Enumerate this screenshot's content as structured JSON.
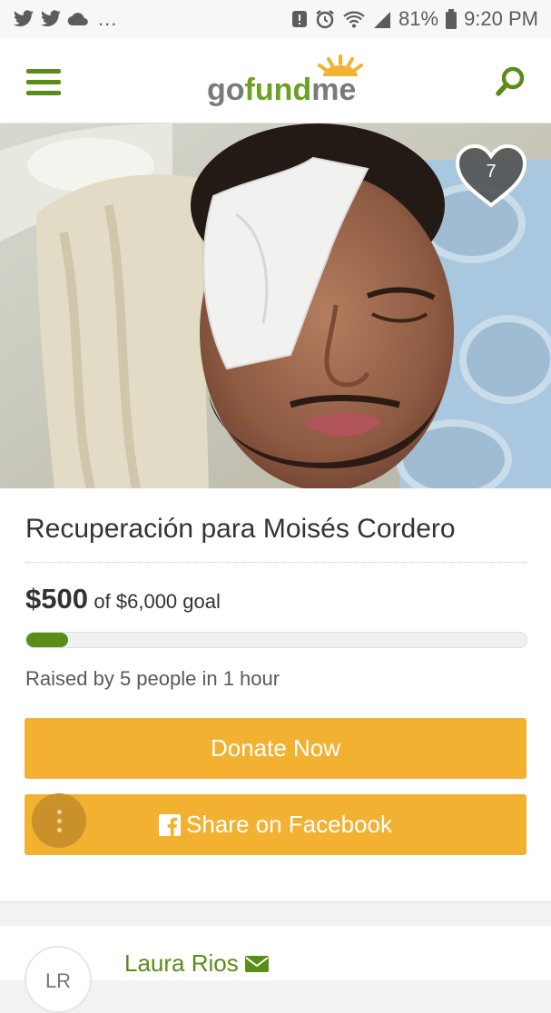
{
  "status_bar": {
    "left_icons": [
      "twitter-icon",
      "twitter-icon",
      "cloud-icon"
    ],
    "more": "...",
    "battery": "81%",
    "time": "9:20 PM"
  },
  "nav": {
    "logo": {
      "part1": "go",
      "part2": "fund",
      "part3": "me"
    }
  },
  "campaign": {
    "heart_count": "7",
    "title": "Recuperación para Moisés Cordero",
    "raised": "$500",
    "goal_text": "of $6,000 goal",
    "progress_fraction": 0.0833,
    "raised_by": "Raised by 5 people in 1 hour",
    "donate_label": "Donate Now",
    "share_label": "Share on Facebook"
  },
  "organizer": {
    "initials": "LR",
    "name": "Laura Rios"
  },
  "colors": {
    "brand_green": "#5a8d18",
    "button_orange": "#f3b132"
  }
}
